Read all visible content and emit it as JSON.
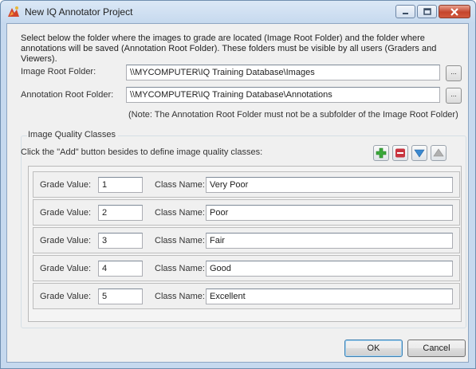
{
  "window": {
    "title": "New IQ Annotator Project"
  },
  "description": "Select below the folder where the images to grade are located (Image Root Folder) and the folder where annotations will be saved (Annotation Root Folder). These folders must be visible by all users (Graders and Viewers).",
  "image_root": {
    "label": "Image Root Folder:",
    "value": "\\\\MYCOMPUTER\\IQ Training Database\\Images",
    "browse_label": "..."
  },
  "annotation_root": {
    "label": "Annotation Root Folder:",
    "value": "\\\\MYCOMPUTER\\IQ Training Database\\Annotations",
    "browse_label": "..."
  },
  "note": "(Note: The Annotation Root Folder must not be a subfolder of the Image Root Folder)",
  "classes_group": {
    "title": "Image Quality Classes",
    "instruction": "Click the \"Add\" button besides to define image quality classes:",
    "grade_label": "Grade Value:",
    "class_label": "Class Name:",
    "rows": [
      {
        "grade": "1",
        "name": "Very Poor"
      },
      {
        "grade": "2",
        "name": "Poor"
      },
      {
        "grade": "3",
        "name": "Fair"
      },
      {
        "grade": "4",
        "name": "Good"
      },
      {
        "grade": "5",
        "name": "Excellent"
      }
    ],
    "tool_icons": [
      "add-icon",
      "remove-icon",
      "move-down-icon",
      "move-up-icon"
    ]
  },
  "buttons": {
    "ok": "OK",
    "cancel": "Cancel"
  },
  "colors": {
    "add": "#3aa83a",
    "remove": "#c8343f",
    "move_down": "#3a88d0",
    "move_up": "#b0b0b0"
  }
}
